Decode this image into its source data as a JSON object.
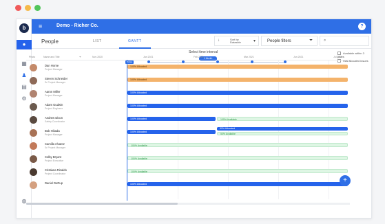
{
  "window_dots": [
    {
      "name": "close-dot",
      "color": "#f05a5a"
    },
    {
      "name": "minimize-dot",
      "color": "#f5b94a"
    },
    {
      "name": "maximize-dot",
      "color": "#52c55a"
    }
  ],
  "app": {
    "logo": "b",
    "title": "Demo - Richer Co.",
    "menu_icon": "hamburger-icon",
    "help": "?"
  },
  "toolbar": {
    "section_title": "People",
    "tabs": [
      {
        "label": "LIST",
        "active": false
      },
      {
        "label": "GANTT",
        "active": true
      }
    ],
    "sort_label_line1": "Sort by",
    "sort_label_line2": "Datasble",
    "filter_label": "People filters",
    "search_placeholder": ""
  },
  "timeline": {
    "label": "Select time interval",
    "selected": "1 Month",
    "options": [
      "Available within 3 years",
      "Has allocated issues"
    ]
  },
  "grid_headers": [
    "Photo",
    "Name and Title",
    "Nov 2020",
    "Jan 2021",
    "Feb 2021",
    "Mar 2021",
    "Jun 2021",
    "Jul 2021"
  ],
  "today_label": "Today",
  "people": [
    {
      "name": "Dan Horne",
      "role": "Project Manager",
      "avatar": "#c48a6a"
    },
    {
      "name": "Steven Schneider",
      "role": "Sr Project Manager",
      "avatar": "#8e6a58"
    },
    {
      "name": "Aaron Miller",
      "role": "Project Manager",
      "avatar": "#b08370"
    },
    {
      "name": "Adam Gudwin",
      "role": "Project Engineer",
      "avatar": "#6b5a4e"
    },
    {
      "name": "Andrew Dixon",
      "role": "Safety Coordinator",
      "avatar": "#5a4a40"
    },
    {
      "name": "Bob Hikada",
      "role": "Project Manager",
      "avatar": "#a87256"
    },
    {
      "name": "Camilla Alvarez",
      "role": "Sr Project Manager",
      "avatar": "#c27a5a"
    },
    {
      "name": "Colby Bryant",
      "role": "Project Executive",
      "avatar": "#7a5a48"
    },
    {
      "name": "Cristiana Rinaldo",
      "role": "Project Coordinator",
      "avatar": "#4a3a30"
    },
    {
      "name": "Daniel DeRup",
      "role": "",
      "avatar": "#d4a080"
    }
  ],
  "bars": [
    [
      {
        "label": "100% Allocated",
        "style": "orange"
      }
    ],
    [
      {
        "label": "100% Allocated",
        "style": "orange"
      }
    ],
    [
      {
        "label": "100% Allocated",
        "style": "blue"
      }
    ],
    [
      {
        "label": "100% Allocated",
        "style": "blue"
      }
    ],
    [
      {
        "label": "100% Allocated",
        "style": "blue"
      },
      {
        "label": "100% Available",
        "style": "green"
      }
    ],
    [
      {
        "label": "100% Allocated",
        "style": "blue"
      },
      {
        "label": "50% Allocated",
        "style": "blue"
      },
      {
        "label": "50% Available",
        "style": "green"
      }
    ],
    [
      {
        "label": "100% Available",
        "style": "green"
      }
    ],
    [
      {
        "label": "100% Available",
        "style": "green"
      }
    ],
    [
      {
        "label": "100% Available",
        "style": "green"
      }
    ],
    [
      {
        "label": "100% Allocated",
        "style": "blue"
      }
    ]
  ],
  "fab_label": "+"
}
